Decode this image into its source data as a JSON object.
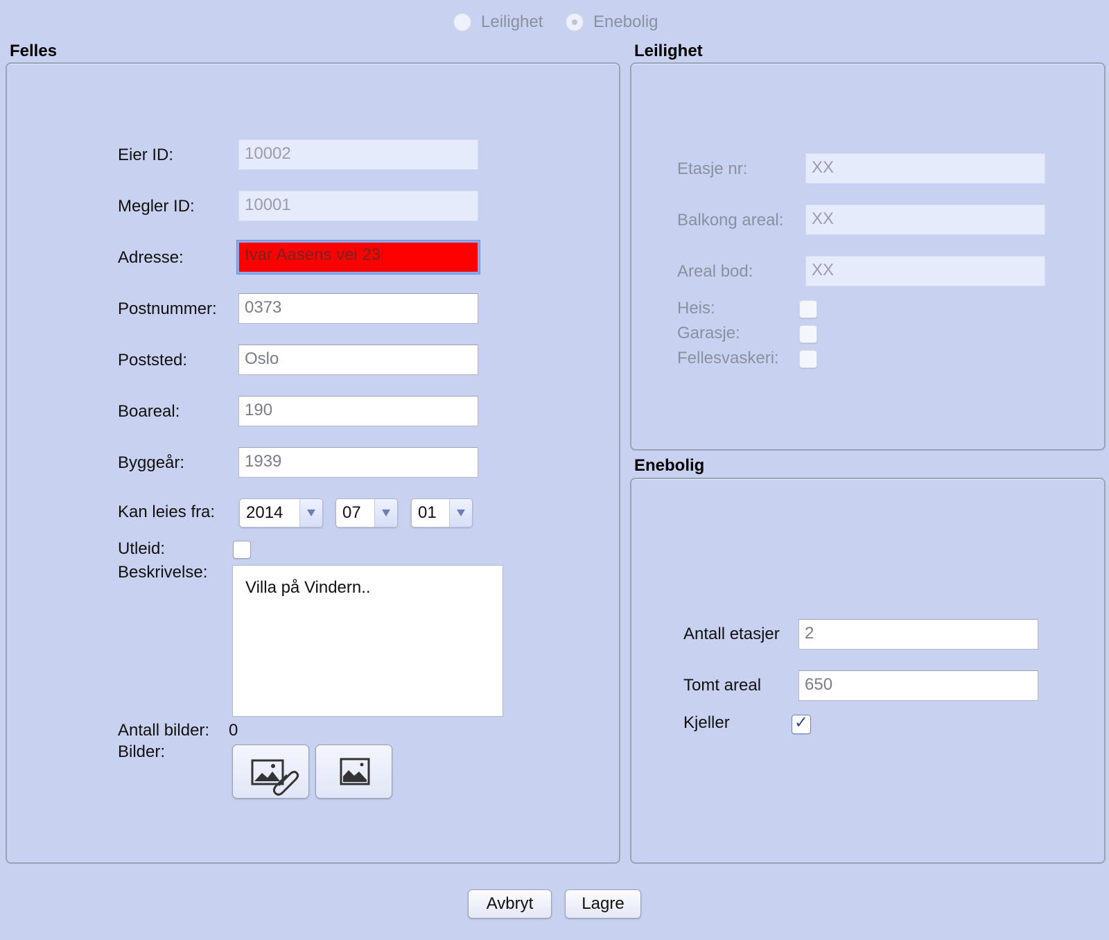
{
  "type_selector": {
    "options": [
      "Leilighet",
      "Enebolig"
    ],
    "selected": "Enebolig"
  },
  "felles": {
    "title": "Felles",
    "eier_id": {
      "label": "Eier ID:",
      "value": "10002"
    },
    "megler_id": {
      "label": "Megler ID:",
      "value": "10001"
    },
    "adresse": {
      "label": "Adresse:",
      "value": "Ivar Aasens vei 23"
    },
    "postnummer": {
      "label": "Postnummer:",
      "value": "0373"
    },
    "poststed": {
      "label": "Poststed:",
      "value": "Oslo"
    },
    "boareal": {
      "label": "Boareal:",
      "value": "190"
    },
    "byggeaar": {
      "label": "Byggeår:",
      "value": "1939"
    },
    "kan_leies_fra": {
      "label": "Kan leies fra:",
      "year": "2014",
      "month": "07",
      "day": "01"
    },
    "utleid": {
      "label": "Utleid:",
      "checked": false
    },
    "beskrivelse": {
      "label": "Beskrivelse:",
      "value": "Villa på Vindern.."
    },
    "antall_bilder": {
      "label": "Antall bilder:",
      "value": "0"
    },
    "bilder": {
      "label": "Bilder:",
      "add_icon": "attach-image-icon",
      "view_icon": "image-icon"
    }
  },
  "leilighet": {
    "title": "Leilighet",
    "etasje_nr": {
      "label": "Etasje nr:",
      "value": "XX"
    },
    "balkong_areal": {
      "label": "Balkong areal:",
      "value": "XX"
    },
    "areal_bod": {
      "label": "Areal bod:",
      "value": "XX"
    },
    "heis": {
      "label": "Heis:",
      "checked": false
    },
    "garasje": {
      "label": "Garasje:",
      "checked": false
    },
    "fellesvaskeri": {
      "label": "Fellesvaskeri:",
      "checked": false
    }
  },
  "enebolig": {
    "title": "Enebolig",
    "antall_etasjer": {
      "label": "Antall etasjer",
      "value": "2"
    },
    "tomt_areal": {
      "label": "Tomt areal",
      "value": "650"
    },
    "kjeller": {
      "label": "Kjeller",
      "checked": true
    }
  },
  "buttons": {
    "cancel": "Avbryt",
    "save": "Lagre"
  },
  "colors": {
    "background": "#c8d1ef",
    "error_field": "#ff0000",
    "focus_ring": "#8ca8e8"
  }
}
